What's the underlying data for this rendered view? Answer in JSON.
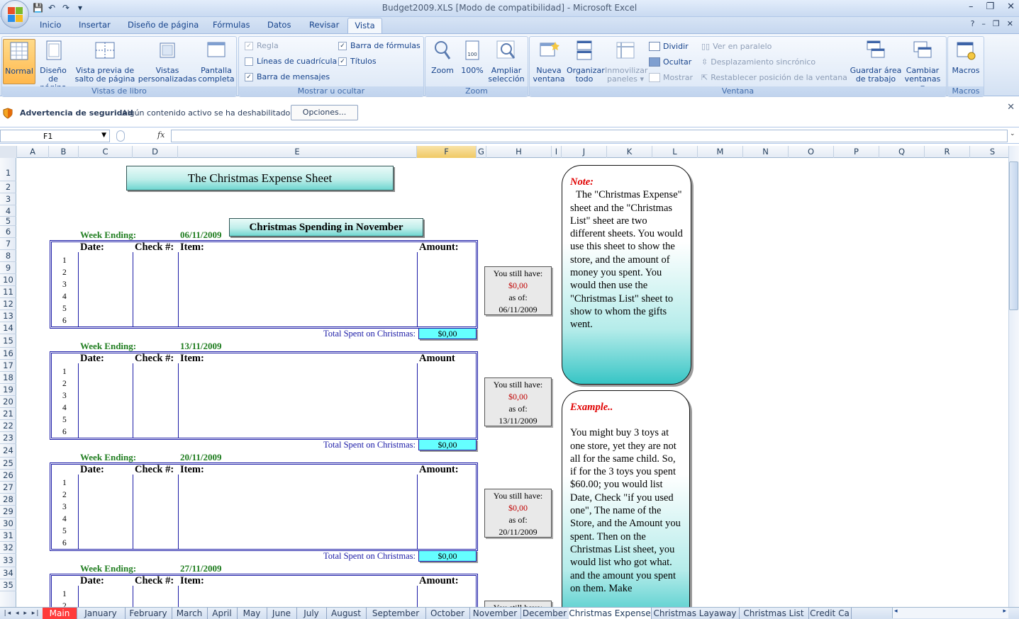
{
  "window": {
    "title": "Budget2009.XLS  [Modo de compatibilidad] - Microsoft Excel",
    "controls": [
      "–",
      "❐",
      "✕"
    ],
    "ribbon_controls": [
      "?",
      "–",
      "❐",
      "✕"
    ]
  },
  "qat": {
    "save": "💾",
    "undo": "↶",
    "redo": "↷",
    "more": "▾"
  },
  "tabs": [
    "Inicio",
    "Insertar",
    "Diseño de página",
    "Fórmulas",
    "Datos",
    "Revisar",
    "Vista"
  ],
  "active_tab": "Vista",
  "ribbon": {
    "vistas_libro": {
      "label": "Vistas de libro",
      "normal": "Normal",
      "diseno": [
        "Diseño",
        "de página"
      ],
      "salto": [
        "Vista previa de",
        "salto de página"
      ],
      "personalizadas": [
        "Vistas",
        "personalizadas"
      ],
      "pantalla": [
        "Pantalla",
        "completa"
      ]
    },
    "mostrar": {
      "label": "Mostrar u ocultar",
      "regla": "Regla",
      "lineas": "Líneas de cuadrícula",
      "mensajes": "Barra de mensajes",
      "formulas": "Barra de fórmulas",
      "titulos": "Títulos"
    },
    "zoom": {
      "label": "Zoom",
      "zoom": "Zoom",
      "cien": "100%",
      "ampliar": [
        "Ampliar",
        "selección"
      ]
    },
    "ventana": {
      "label": "Ventana",
      "nueva": [
        "Nueva",
        "ventana"
      ],
      "organizar": [
        "Organizar",
        "todo"
      ],
      "inmovilizar": [
        "Inmovilizar",
        "paneles ▾"
      ],
      "dividir": "Dividir",
      "ocultar": "Ocultar",
      "mostrar": "Mostrar",
      "paralelo": "Ver en paralelo",
      "sincronico": "Desplazamiento sincrónico",
      "restablecer": "Restablecer posición de la ventana",
      "guardar": [
        "Guardar área",
        "de trabajo"
      ],
      "cambiar": [
        "Cambiar",
        "ventanas ▾"
      ]
    },
    "macros": {
      "label": "Macros",
      "macros": "Macros"
    }
  },
  "security": {
    "title": "Advertencia de seguridad",
    "text": "Algún contenido activo se ha deshabilitado.",
    "button": "Opciones...",
    "close": "✕"
  },
  "formula_bar": {
    "namebox": "F1",
    "fx": "fx",
    "value": ""
  },
  "columns": [
    "A",
    "B",
    "C",
    "D",
    "E",
    "F",
    "G",
    "H",
    "I",
    "J",
    "K",
    "L",
    "M",
    "N",
    "O",
    "P",
    "Q",
    "R",
    "S"
  ],
  "rows": [
    "1",
    "2",
    "3",
    "4",
    "5",
    "6",
    "7",
    "8",
    "9",
    "10",
    "11",
    "12",
    "13",
    "14",
    "15",
    "16",
    "17",
    "18",
    "19",
    "20",
    "21",
    "22",
    "23",
    "24",
    "25",
    "26",
    "27",
    "28",
    "29",
    "30",
    "31",
    "32",
    "33",
    "34",
    "35"
  ],
  "sheet": {
    "title": "The Christmas Expense Sheet",
    "subtitle": "Christmas Spending in November",
    "week_label": "Week Ending:",
    "total_label": "Total Spent on Christmas:",
    "still_have": "You still have:",
    "as_of": "as of:",
    "weeks": [
      {
        "date": "06/11/2009",
        "headers": [
          "Date:",
          "Check #:",
          "Item:",
          "Amount:"
        ],
        "items": [
          "1",
          "2",
          "3",
          "4",
          "5",
          "6"
        ],
        "total": "$0,00",
        "remaining": "$0,00"
      },
      {
        "date": "13/11/2009",
        "headers": [
          "Date:",
          "Check #:",
          "Item:",
          "Amount"
        ],
        "items": [
          "1",
          "2",
          "3",
          "4",
          "5",
          "6"
        ],
        "total": "$0,00",
        "remaining": "$0,00"
      },
      {
        "date": "20/11/2009",
        "headers": [
          "Date:",
          "Check #:",
          "Item:",
          "Amount:"
        ],
        "items": [
          "1",
          "2",
          "3",
          "4",
          "5",
          "6"
        ],
        "total": "$0,00",
        "remaining": "$0,00"
      },
      {
        "date": "27/11/2009",
        "headers": [
          "Date:",
          "Check #:",
          "Item:",
          "Amount:"
        ],
        "items": [
          "1",
          "2"
        ],
        "total": "",
        "remaining": ""
      }
    ],
    "still_partial": "You still have:",
    "note": {
      "head": "Note:",
      "body": "The \"Christmas Expense\" sheet and the \"Christmas List\" sheet are two different sheets. You would use this sheet to show the store, and the amount of money you spent. You would then use the \"Christmas List\" sheet to show to whom the gifts went."
    },
    "example": {
      "head": "Example..",
      "body": "You might buy 3 toys at one store, yet they are not all for the same child. So, if for the 3 toys you spent $60.00; you would list Date, Check \"if you used one\", The name of the Store, and the Amount you spent. Then on the Christmas List sheet, you would list  who got what. and the amount you spent on them. Make"
    }
  },
  "sheet_tabs": [
    "Main",
    "January",
    "February",
    "March",
    "April",
    "May",
    "June",
    "July",
    "August",
    "September",
    "October",
    "November",
    "December",
    "Christmas Expense",
    "Christmas Layaway",
    "Christmas List",
    "Credit Ca"
  ],
  "active_sheet": "Christmas Expense",
  "colors": {
    "accent_tab": "#ff3b3b",
    "teal": "#65ffff",
    "note_red": "#e00000",
    "week_green": "#1f7d1f"
  }
}
